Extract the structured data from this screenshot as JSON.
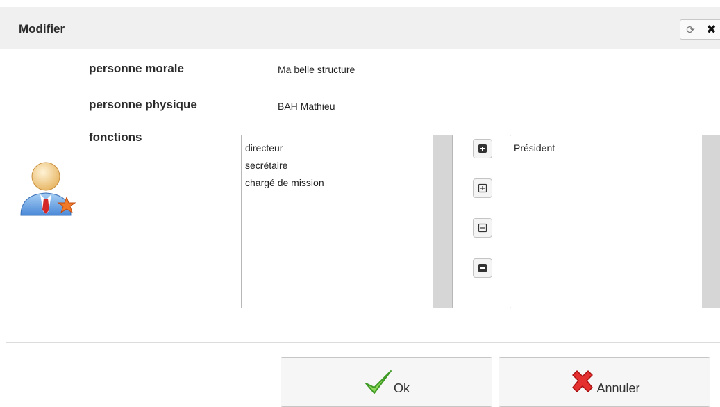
{
  "dialog": {
    "title": "Modifier",
    "refresh_icon": "refresh-icon",
    "close_icon": "close-icon"
  },
  "fields": {
    "morale_label": "personne morale",
    "morale_value": "Ma belle structure",
    "physique_label": "personne physique",
    "physique_value": "BAH Mathieu",
    "fonctions_label": "fonctions"
  },
  "available_list": [
    "directeur",
    "secrétaire",
    "chargé de mission"
  ],
  "selected_list": [
    "Président"
  ],
  "move_buttons": [
    "add-one-icon",
    "add-all-icon",
    "remove-all-icon",
    "remove-one-icon"
  ],
  "buttons": {
    "ok_label": "Ok",
    "cancel_label": "Annuler"
  }
}
